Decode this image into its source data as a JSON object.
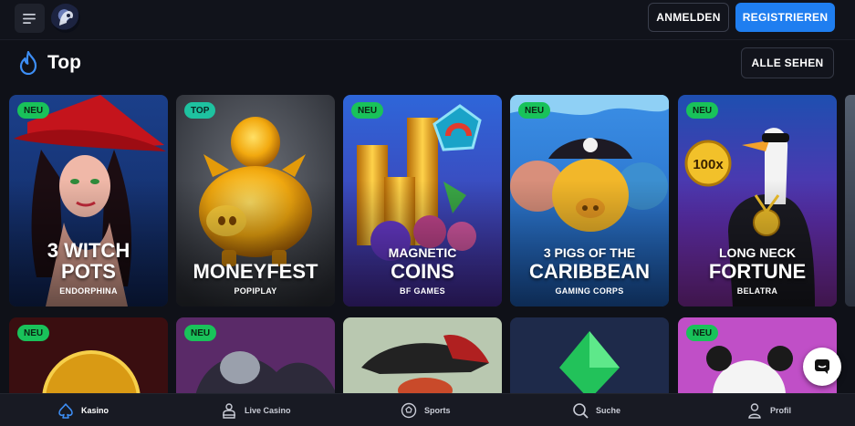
{
  "header": {
    "login_label": "ANMELDEN",
    "register_label": "REGISTRIEREN",
    "menu_icon": "hamburger-menu-icon",
    "logo_icon": "site-logo"
  },
  "section": {
    "title": "Top",
    "see_all_label": "ALLE SEHEN",
    "icon": "flame-icon"
  },
  "games": [
    {
      "badge": "NEU",
      "title_line1": "3 WITCH",
      "title_line2": "POTS",
      "provider": "ENDORPHINA"
    },
    {
      "badge": "TOP",
      "title_line1": "",
      "title_line2": "MONEYFEST",
      "provider": "POPIPLAY"
    },
    {
      "badge": "NEU",
      "title_line1": "MAGNETIC",
      "title_line2": "COINS",
      "provider": "BF GAMES"
    },
    {
      "badge": "NEU",
      "title_line1": "3 PIGS OF THE",
      "title_line2": "CARIBBEAN",
      "provider": "GAMING CORPS"
    },
    {
      "badge": "NEU",
      "title_line1": "LONG NECK",
      "title_line2": "FORTUNE",
      "provider": "BELATRA"
    }
  ],
  "games_row2": [
    {
      "badge": "NEU"
    },
    {
      "badge": "NEU"
    },
    {
      "badge": ""
    },
    {
      "badge": ""
    },
    {
      "badge": "NEU"
    }
  ],
  "coin_label": "100x",
  "nav": {
    "kasino": "Kasino",
    "live": "Live Casino",
    "sports": "Sports",
    "search": "Suche",
    "profile": "Profil"
  },
  "colors": {
    "accent": "#1f7ef0",
    "badge_new": "#19c25a",
    "badge_top": "#1ec2a0",
    "background": "#0f1118"
  }
}
